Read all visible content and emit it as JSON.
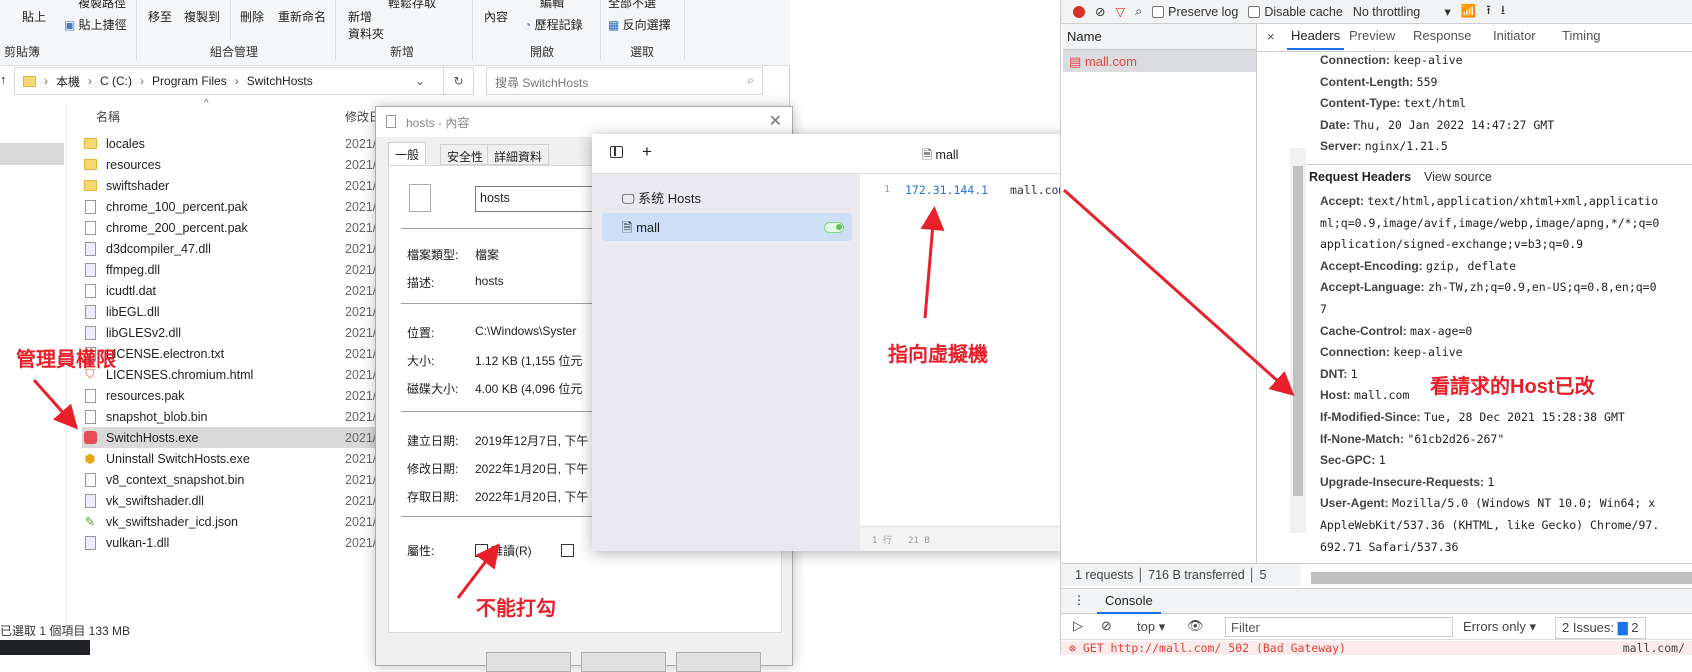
{
  "explorer": {
    "ribbon": {
      "clipboard": {
        "paste": "貼上",
        "copy_path": "複製路徑",
        "paste_shortcut": "貼上捷徑",
        "group": "剪貼簿"
      },
      "organize": {
        "move_to": "移至",
        "copy_to": "複製到",
        "delete": "刪除",
        "rename": "重新命名",
        "group": "組合管理"
      },
      "new": {
        "new_folder_line1": "新增",
        "new_folder_line2": "資料夾",
        "easy_access": "輕鬆存取",
        "group": "新增"
      },
      "open": {
        "properties": "內容",
        "edit": "編輯",
        "history": "歷程記錄",
        "group": "開啟"
      },
      "select": {
        "select_none": "全部不選",
        "invert": "反向選擇",
        "group": "選取"
      }
    },
    "breadcrumb": [
      "本機",
      "C (C:)",
      "Program Files",
      "SwitchHosts"
    ],
    "search_placeholder": "搜尋 SwitchHosts",
    "columns": {
      "name": "名稱",
      "modified": "修改日"
    },
    "files": [
      {
        "name": "locales",
        "type": "folder",
        "date": "2021/"
      },
      {
        "name": "resources",
        "type": "folder",
        "date": "2021/"
      },
      {
        "name": "swiftshader",
        "type": "folder",
        "date": "2021/"
      },
      {
        "name": "chrome_100_percent.pak",
        "type": "file",
        "date": "2021/"
      },
      {
        "name": "chrome_200_percent.pak",
        "type": "file",
        "date": "2021/"
      },
      {
        "name": "d3dcompiler_47.dll",
        "type": "dll",
        "date": "2021/"
      },
      {
        "name": "ffmpeg.dll",
        "type": "dll",
        "date": "2021/"
      },
      {
        "name": "icudtl.dat",
        "type": "file",
        "date": "2021/"
      },
      {
        "name": "libEGL.dll",
        "type": "dll",
        "date": "2021/"
      },
      {
        "name": "libGLESv2.dll",
        "type": "dll",
        "date": "2021/"
      },
      {
        "name": "LICENSE.electron.txt",
        "type": "txt",
        "date": "2021/"
      },
      {
        "name": "LICENSES.chromium.html",
        "type": "html",
        "date": "2021/"
      },
      {
        "name": "resources.pak",
        "type": "file",
        "date": "2021/"
      },
      {
        "name": "snapshot_blob.bin",
        "type": "file",
        "date": "2021/"
      },
      {
        "name": "SwitchHosts.exe",
        "type": "exe",
        "date": "2021/",
        "selected": true
      },
      {
        "name": "Uninstall SwitchHosts.exe",
        "type": "uninstall",
        "date": "2021/"
      },
      {
        "name": "v8_context_snapshot.bin",
        "type": "file",
        "date": "2021/"
      },
      {
        "name": "vk_swiftshader.dll",
        "type": "dll",
        "date": "2021/"
      },
      {
        "name": "vk_swiftshader_icd.json",
        "type": "json",
        "date": "2021/"
      },
      {
        "name": "vulkan-1.dll",
        "type": "dll",
        "date": "2021/"
      }
    ],
    "status": "已選取 1 個項目  133 MB"
  },
  "properties_dialog": {
    "title": "hosts - 內容",
    "tabs": [
      "一般",
      "安全性",
      "詳細資料"
    ],
    "filename": "hosts",
    "rows": [
      {
        "label": "檔案類型:",
        "value": "檔案"
      },
      {
        "label": "描述:",
        "value": "hosts"
      },
      {
        "label": "位置:",
        "value": "C:\\Windows\\Syster"
      },
      {
        "label": "大小:",
        "value": "1.12 KB (1,155 位元"
      },
      {
        "label": "磁碟大小:",
        "value": "4.00 KB (4,096 位元"
      },
      {
        "label": "建立日期:",
        "value": "2019年12月7日, 下午"
      },
      {
        "label": "修改日期:",
        "value": "2022年1月20日, 下午"
      },
      {
        "label": "存取日期:",
        "value": "2022年1月20日, 下午"
      }
    ],
    "attributes_label": "屬性:",
    "readonly_label": "唯讀(R)",
    "readonly_checked": false
  },
  "switchhosts": {
    "title": "mall",
    "sidebar": [
      {
        "label": "系统 Hosts",
        "icon": "monitor-icon"
      },
      {
        "label": "mall",
        "icon": "file-icon",
        "active": true,
        "enabled": true
      }
    ],
    "editor": {
      "line_number": "1",
      "ip": "172.31.144.1",
      "host": "mall.com"
    },
    "footer": {
      "lines": "1 行",
      "size": "21 B"
    },
    "toggle_color": "#7ed67e"
  },
  "devtools": {
    "toolbar": {
      "preserve_log": "Preserve log",
      "disable_cache": "Disable cache",
      "throttling": "No throttling"
    },
    "name_header": "Name",
    "requests": [
      {
        "name": "mall.com",
        "color": "#e8453c"
      }
    ],
    "tabs": [
      "Headers",
      "Preview",
      "Response",
      "Initiator",
      "Timing"
    ],
    "active_tab": "Headers",
    "response_headers": [
      {
        "k": "Connection:",
        "v": "keep-alive"
      },
      {
        "k": "Content-Length:",
        "v": "559"
      },
      {
        "k": "Content-Type:",
        "v": "text/html"
      },
      {
        "k": "Date:",
        "v": "Thu, 20 Jan 2022 14:47:27 GMT"
      },
      {
        "k": "Server:",
        "v": "nginx/1.21.5"
      }
    ],
    "request_headers_title": "Request Headers",
    "view_source": "View source",
    "request_headers": [
      {
        "k": "Accept:",
        "v": "text/html,application/xhtml+xml,applicatio"
      },
      {
        "k": "",
        "v": "ml;q=0.9,image/avif,image/webp,image/apng,*/*;q=0"
      },
      {
        "k": "",
        "v": "application/signed-exchange;v=b3;q=0.9"
      },
      {
        "k": "Accept-Encoding:",
        "v": "gzip, deflate"
      },
      {
        "k": "Accept-Language:",
        "v": "zh-TW,zh;q=0.9,en-US;q=0.8,en;q=0"
      },
      {
        "k": "",
        "v": "7"
      },
      {
        "k": "Cache-Control:",
        "v": "max-age=0"
      },
      {
        "k": "Connection:",
        "v": "keep-alive"
      },
      {
        "k": "DNT:",
        "v": "1"
      },
      {
        "k": "Host:",
        "v": "mall.com"
      },
      {
        "k": "If-Modified-Since:",
        "v": "Tue, 28 Dec 2021 15:28:38 GMT"
      },
      {
        "k": "If-None-Match:",
        "v": "\"61cb2d26-267\""
      },
      {
        "k": "Sec-GPC:",
        "v": "1"
      },
      {
        "k": "Upgrade-Insecure-Requests:",
        "v": "1"
      },
      {
        "k": "User-Agent:",
        "v": "Mozilla/5.0 (Windows NT 10.0; Win64; x"
      },
      {
        "k": "",
        "v": "AppleWebKit/537.36 (KHTML, like Gecko) Chrome/97."
      },
      {
        "k": "",
        "v": "692.71 Safari/537.36"
      }
    ],
    "summary": {
      "requests": "1 requests",
      "transferred": "716 B transferred",
      "more": "5"
    },
    "console_tab": "Console",
    "console_context": "top",
    "console_filter_placeholder": "Filter",
    "log_level": "Errors only",
    "issues": "2 Issues:",
    "issues_count": "2",
    "error_line": "GET http://mall.com/ 502 (Bad Gateway)",
    "error_source": "mall.com/"
  },
  "annotations": {
    "admin": "管理員權限",
    "point_vm": "指向虛擬機",
    "host_changed": "看請求的Host已改",
    "cannot_check": "不能打勾",
    "color": "#e8202a"
  }
}
